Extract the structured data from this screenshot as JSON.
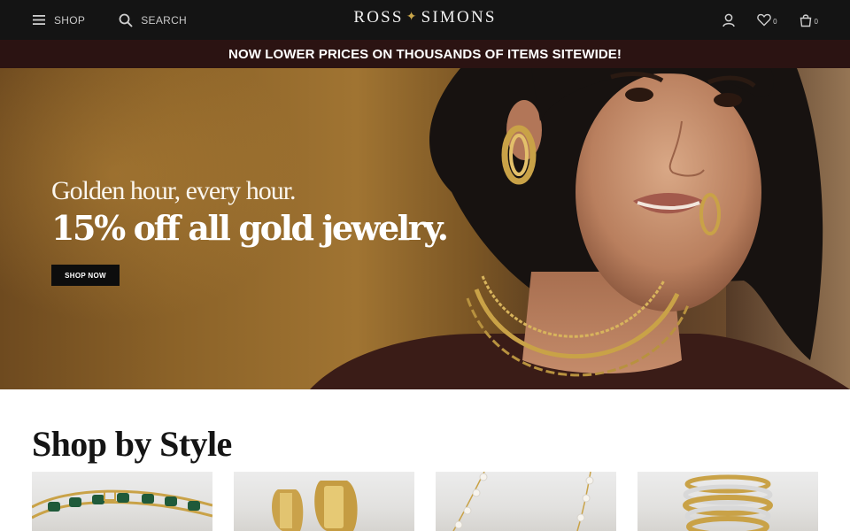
{
  "header": {
    "menu_label": "SHOP",
    "search_label": "SEARCH",
    "logo_left": "ROSS",
    "logo_right": "SIMONS",
    "wishlist_count": "0",
    "cart_count": "0"
  },
  "promo": {
    "text": "NOW LOWER PRICES ON THOUSANDS OF ITEMS SITEWIDE!"
  },
  "hero": {
    "subtitle": "Golden hour, every hour.",
    "title": "15% off all gold jewelry.",
    "cta_label": "SHOP NOW"
  },
  "shop_by_style": {
    "title": "Shop by Style",
    "cards": [
      "bracelets",
      "earrings",
      "necklaces",
      "rings"
    ]
  },
  "colors": {
    "nav_bg": "#141414",
    "promo_bg": "#2b1312",
    "gold": "#c9a64a"
  }
}
